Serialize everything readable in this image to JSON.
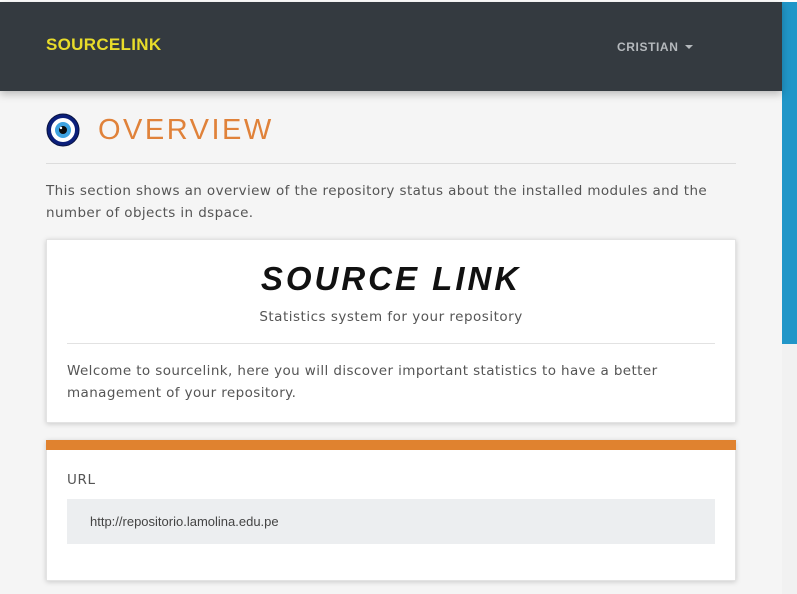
{
  "navbar": {
    "brand": "SOURCELINK",
    "user": "CRISTIAN"
  },
  "page": {
    "title": "OVERVIEW",
    "icon": "eye-icon",
    "intro": "This section shows an overview of the repository status about the installed modules and the number of objects in dspace."
  },
  "welcome_card": {
    "title": "SOURCE LINK",
    "subtitle": "Statistics system for your repository",
    "text": "Welcome to sourcelink, here you will discover important statistics to have a better management of your repository."
  },
  "url_card": {
    "label": "URL",
    "value": "http://repositorio.lamolina.edu.pe"
  },
  "colors": {
    "navbar_bg": "#343a40",
    "brand": "#e8dc2a",
    "accent": "#e0822f",
    "scrollbar": "#2196c8"
  }
}
